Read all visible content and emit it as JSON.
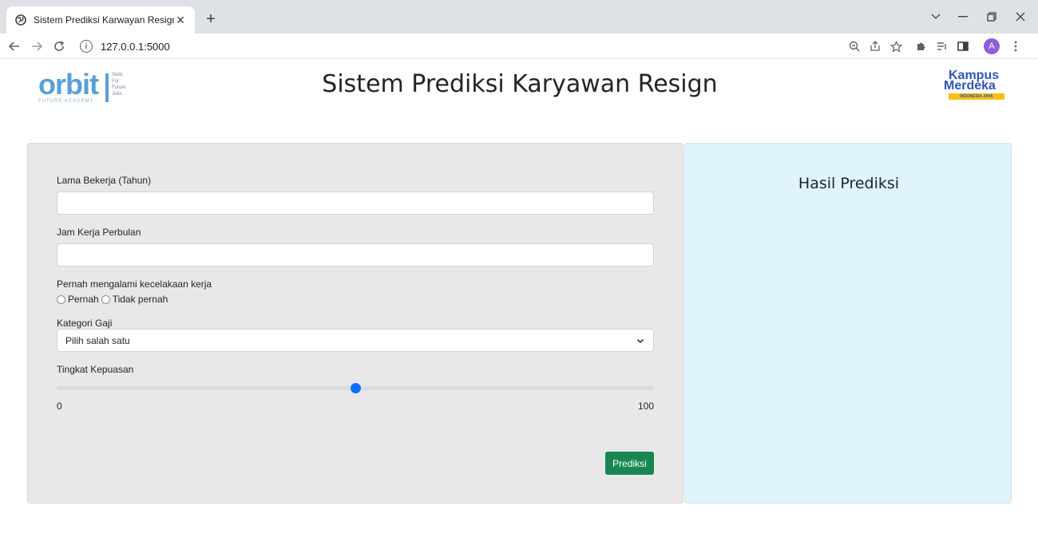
{
  "browser": {
    "tab_title": "Sistem Prediksi Karwayan Resign",
    "tab_close": "✕",
    "new_tab": "+",
    "url": "127.0.0.1:5000",
    "avatar_initial": "A"
  },
  "header": {
    "title": "Sistem Prediksi Karyawan Resign",
    "logo_left": {
      "word": "orbit",
      "subtitle": "FUTURE ACADEMY",
      "tagline": [
        "Skills",
        "For",
        "Future",
        "Jobs"
      ]
    },
    "logo_right": {
      "line1": "Kampus",
      "line2": "Merdeka",
      "ribbon": "INDONESIA JAYA"
    }
  },
  "form": {
    "lama_bekerja": {
      "label": "Lama Bekerja (Tahun)",
      "value": ""
    },
    "jam_kerja": {
      "label": "Jam Kerja Perbulan",
      "value": ""
    },
    "kecelakaan": {
      "label": "Pernah mengalami kecelakaan kerja",
      "options": [
        "Pernah",
        "Tidak pernah"
      ]
    },
    "kategori_gaji": {
      "label": "Kategori Gaji",
      "selected": "Pilih salah satu"
    },
    "kepuasan": {
      "label": "Tingkat Kepuasan",
      "min": "0",
      "max": "100",
      "value": 50
    },
    "submit_label": "Prediksi"
  },
  "result": {
    "title": "Hasil Prediksi"
  },
  "colors": {
    "form_bg": "#e8e8e8",
    "result_bg": "#e0f4fd",
    "submit": "#198754",
    "slider_thumb": "#0d6efd"
  }
}
